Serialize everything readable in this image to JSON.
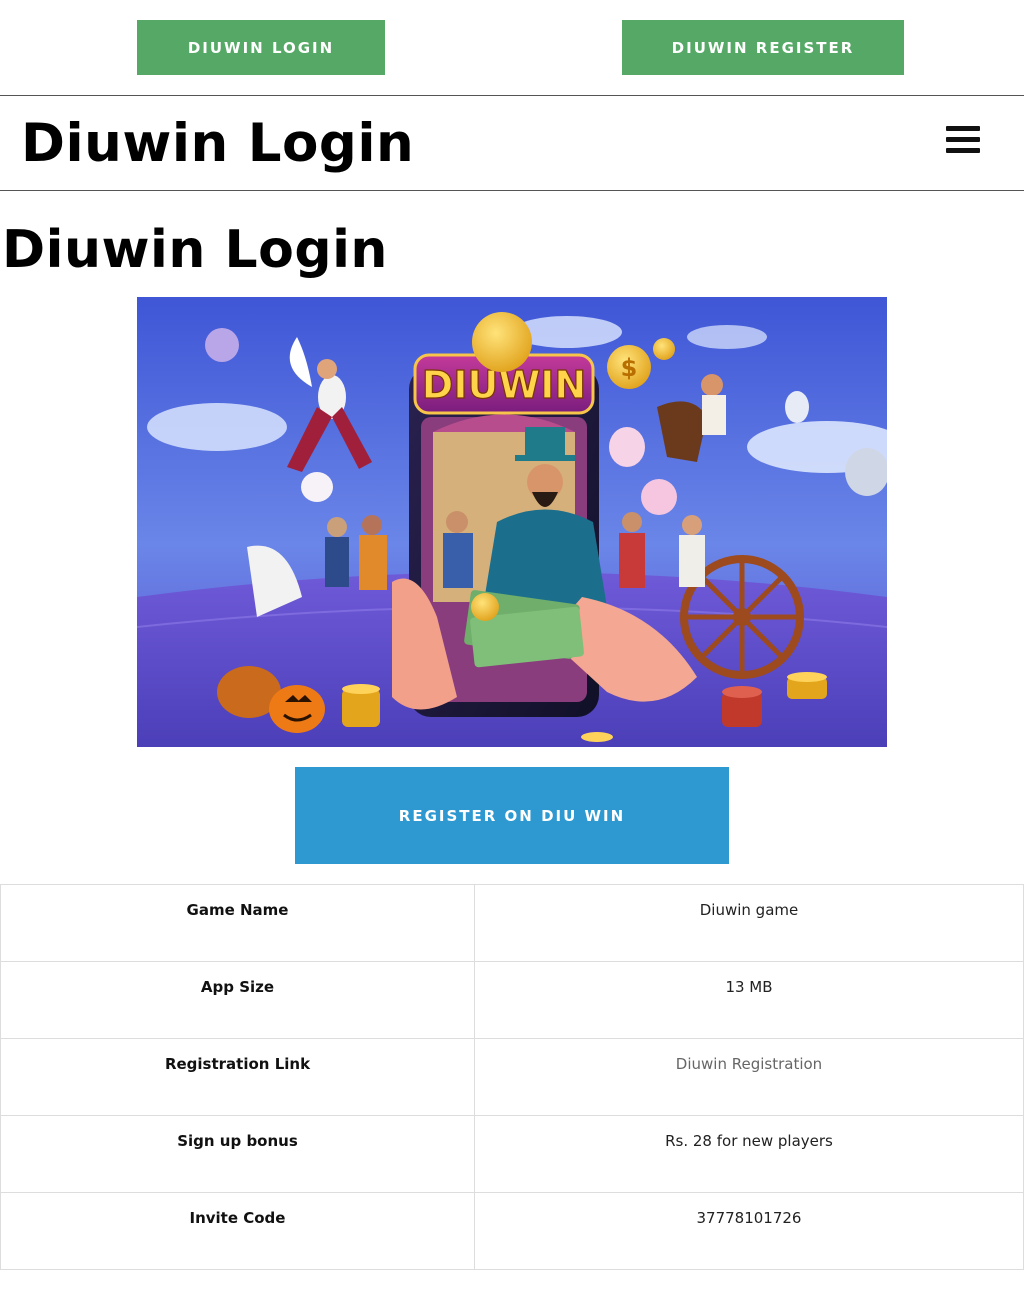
{
  "top_buttons": {
    "login_label": "DIUWIN LOGIN",
    "register_label": "DIUWIN REGISTER",
    "color": "#55a865"
  },
  "header": {
    "site_title": "Diuwin Login",
    "menu_icon": "hamburger-menu-icon"
  },
  "main": {
    "page_title": "Diuwin Login",
    "hero_image_alt": "DIUWIN",
    "cta_label": "REGISTER ON DIU WIN",
    "cta_color": "#2d99d0"
  },
  "info_table": {
    "rows": [
      {
        "key": "Game Name",
        "value": "Diuwin game"
      },
      {
        "key": "App Size",
        "value": "13 MB"
      },
      {
        "key": "Registration Link",
        "value": "Diuwin Registration"
      },
      {
        "key": "Sign up bonus",
        "value": "Rs. 28 for new players"
      },
      {
        "key": "Invite Code",
        "value": "37778101726"
      }
    ]
  }
}
